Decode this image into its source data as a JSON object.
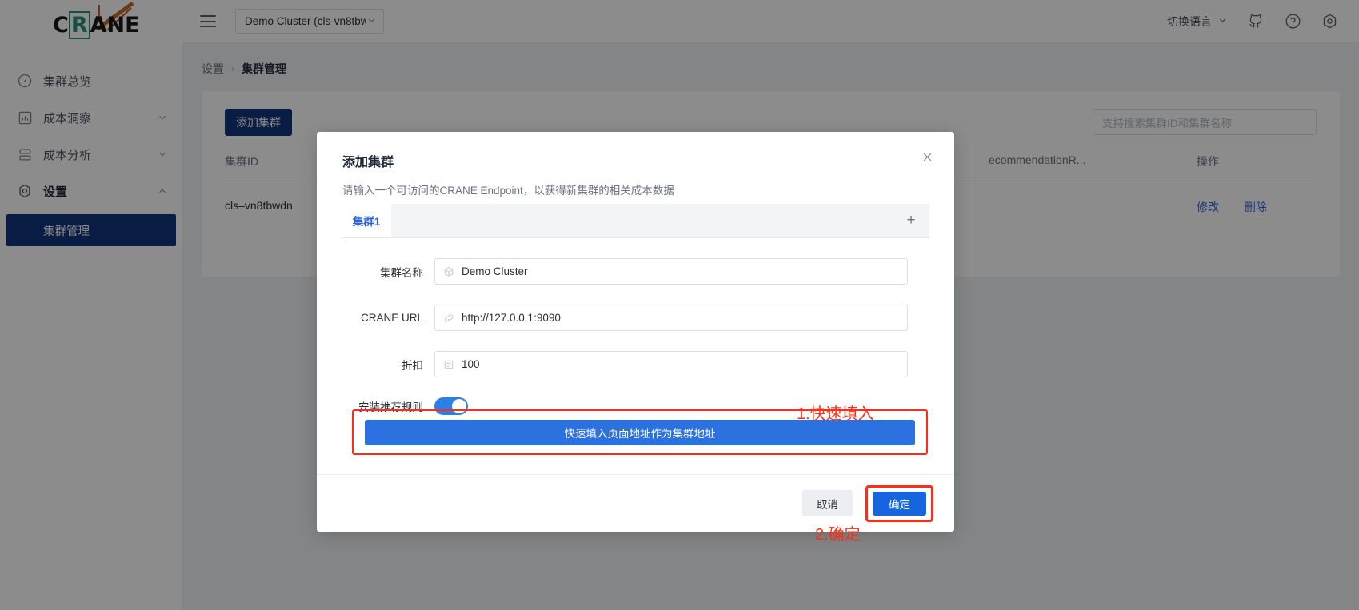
{
  "brand": {
    "logo_text_1": "C",
    "logo_text_r": "R",
    "logo_text_2": "ANE"
  },
  "topbar": {
    "menu_icon": "hamburger-icon",
    "cluster_select_value": "Demo Cluster (cls-vn8tbwc",
    "lang_label": "切换语言",
    "icons": [
      "github-icon",
      "help-icon",
      "gear-icon"
    ]
  },
  "sidebar": {
    "items": [
      {
        "label": "集群总览",
        "icon": "dashboard-icon",
        "expandable": false
      },
      {
        "label": "成本洞察",
        "icon": "bar-chart-icon",
        "expandable": true
      },
      {
        "label": "成本分析",
        "icon": "layers-icon",
        "expandable": true
      },
      {
        "label": "设置",
        "icon": "gear-icon",
        "expandable": true,
        "expanded": true
      }
    ],
    "sub_item": {
      "label": "集群管理"
    }
  },
  "breadcrumb": {
    "parent": "设置",
    "separator": "›",
    "current": "集群管理"
  },
  "page": {
    "add_cluster_button": "添加集群",
    "search_placeholder": "支持搜索集群ID和集群名称",
    "table": {
      "headers": [
        "集群ID",
        "",
        "ecommendationR...",
        "操作"
      ],
      "rows": [
        {
          "cluster_id": "cls–vn8tbwdn",
          "col2": "",
          "col3": "",
          "actions": [
            "修改",
            "删除"
          ]
        }
      ]
    }
  },
  "modal": {
    "title": "添加集群",
    "close_icon": "close-icon",
    "description": "请输入一个可访问的CRANE Endpoint，以获得新集群的相关成本数据",
    "tabs": [
      {
        "label": "集群1",
        "active": true
      }
    ],
    "add_tab_icon": "plus-icon",
    "fields": [
      {
        "label": "集群名称",
        "value": "Demo Cluster",
        "icon": "cube-icon"
      },
      {
        "label": "CRANE URL",
        "value": "http://127.0.0.1:9090",
        "icon": "link-icon"
      },
      {
        "label": "折扣",
        "value": "100",
        "icon": "list-icon"
      }
    ],
    "switch": {
      "label": "安装推荐规则",
      "on": true
    },
    "quick_fill_button": "快速填入页面地址作为集群地址",
    "cancel_button": "取消",
    "confirm_button": "确定"
  },
  "annotations": [
    {
      "text": "1.快速填入",
      "color": "#ff2d16"
    },
    {
      "text": "2.确定",
      "color": "#ff2d16"
    }
  ],
  "colors": {
    "brand_navy": "#11337a",
    "primary_blue": "#1564e0",
    "quickfill_blue": "#2b72e0",
    "annotation_red": "#ff2d16",
    "link_blue": "#2b5fd9"
  }
}
